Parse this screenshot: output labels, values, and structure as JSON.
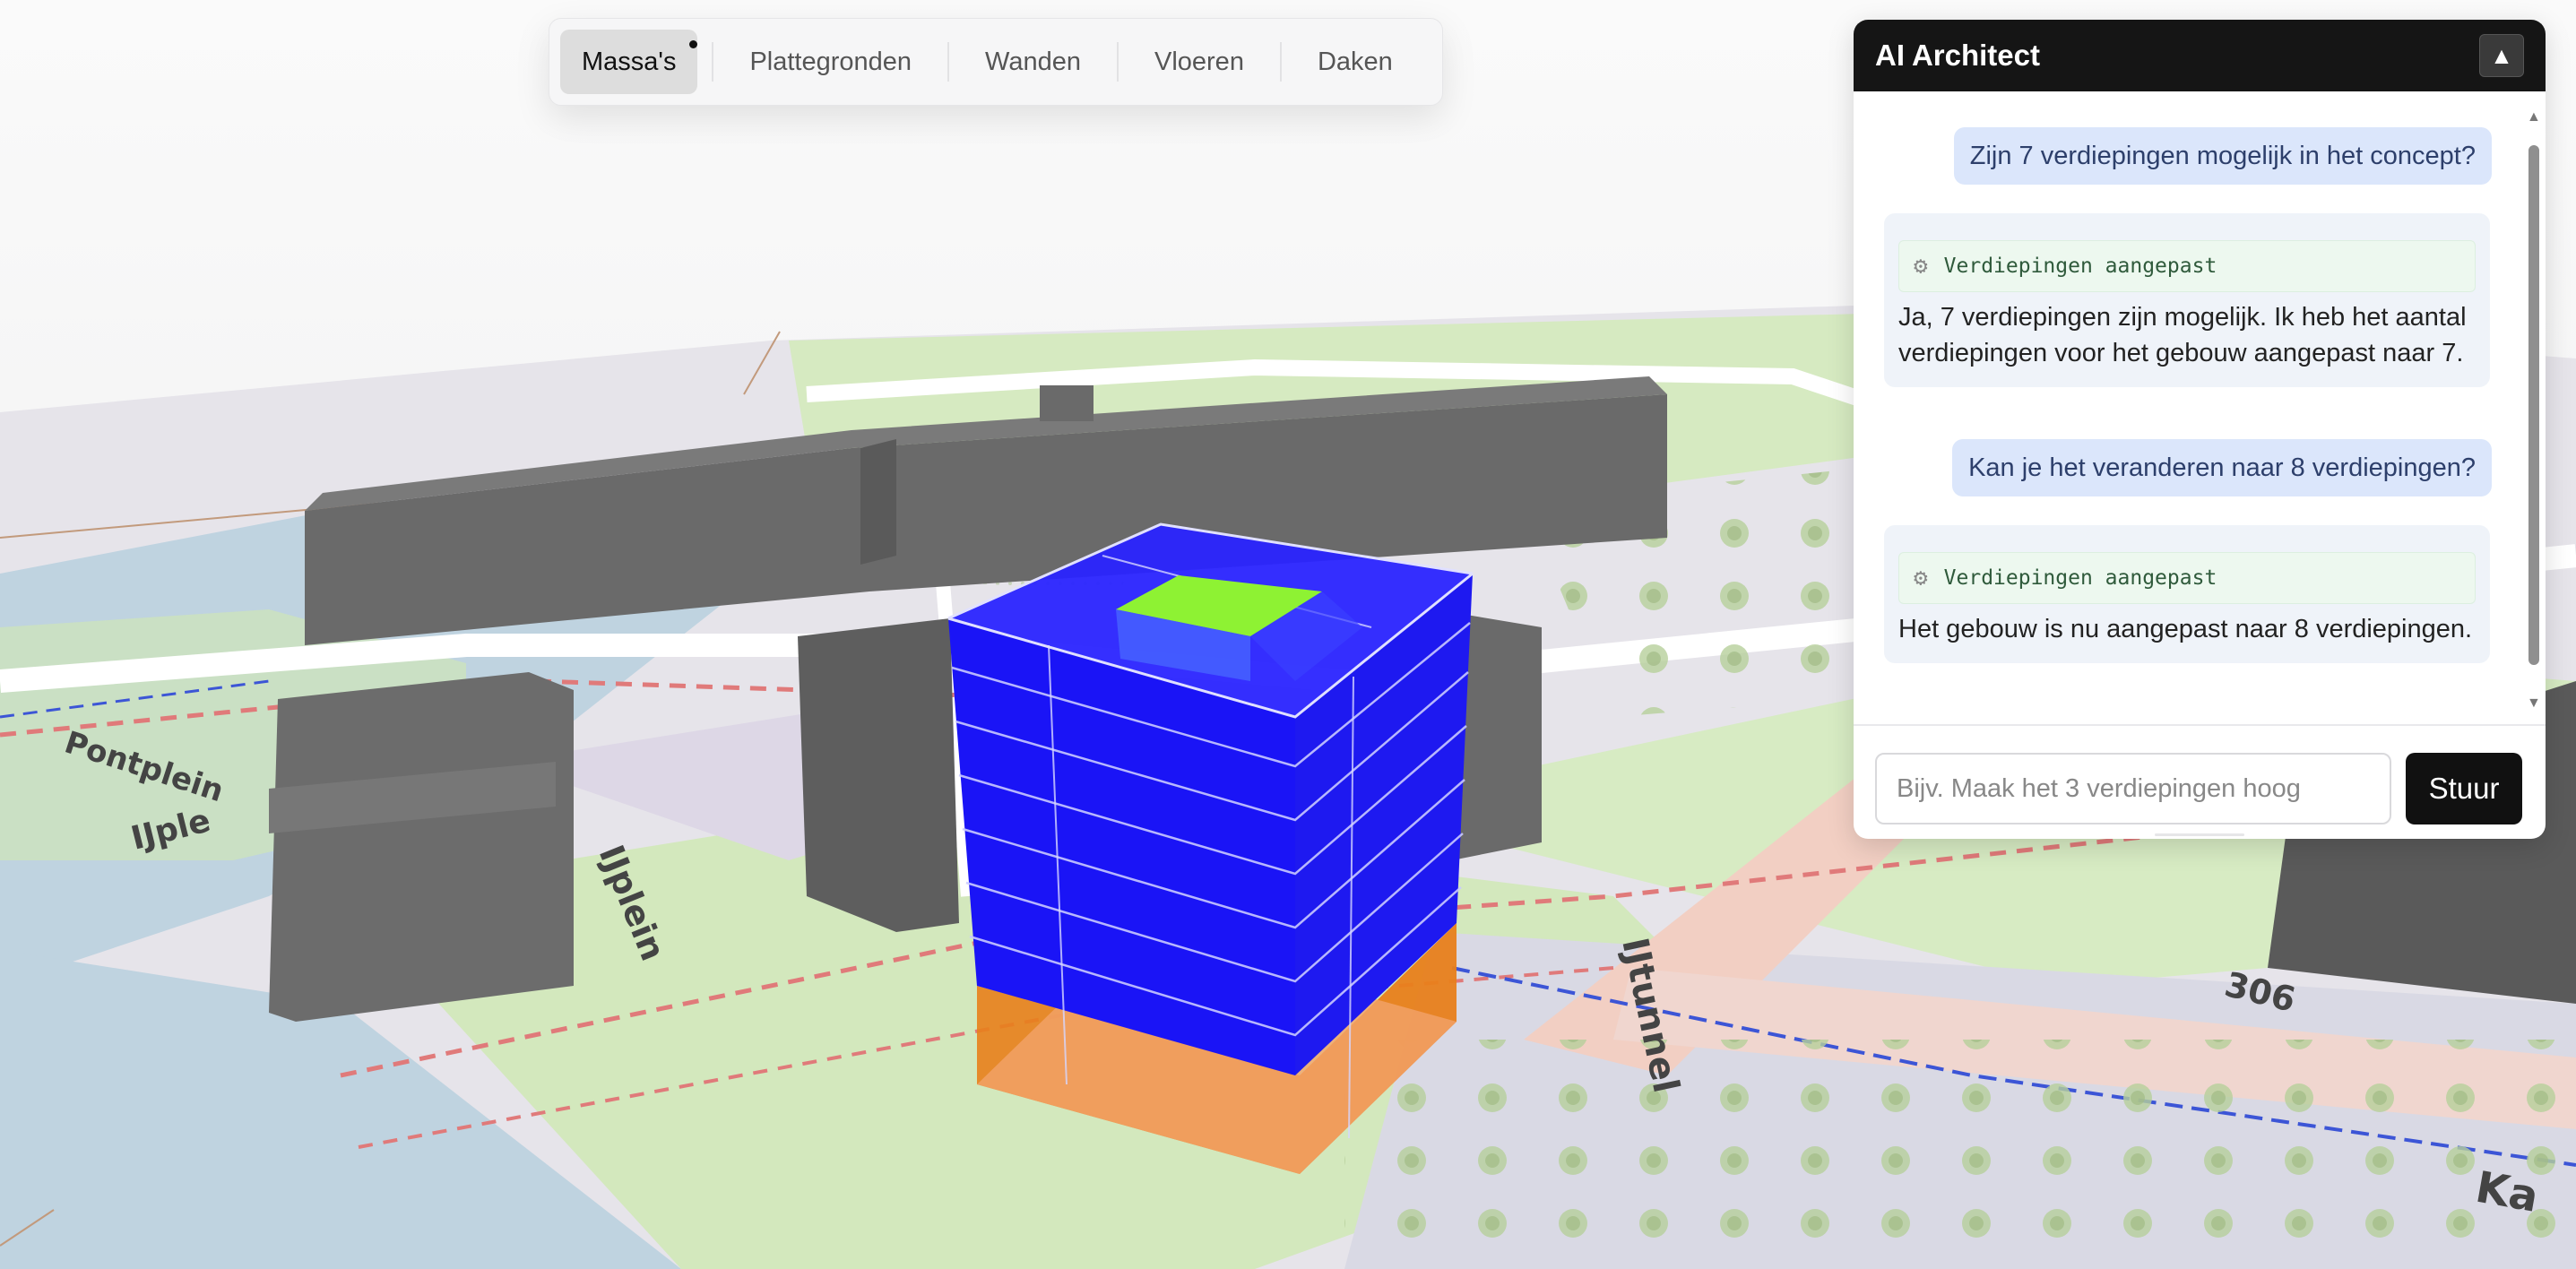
{
  "app": {
    "title": "AI Architect"
  },
  "toolbar": {
    "tabs": [
      {
        "label": "Massa's",
        "active": true
      },
      {
        "label": "Plattegronden",
        "active": false
      },
      {
        "label": "Wanden",
        "active": false
      },
      {
        "label": "Vloeren",
        "active": false
      },
      {
        "label": "Daken",
        "active": false
      }
    ]
  },
  "panel": {
    "title": "AI Architect",
    "collapse_icon": "triangle-up-icon",
    "messages": [
      {
        "role": "user",
        "text": "Zijn 7 verdiepingen mogelijk in het concept?"
      },
      {
        "role": "assistant",
        "tool": "Verdiepingen aangepast",
        "text": "Ja, 7 verdiepingen zijn mogelijk. Ik heb het aantal verdiepingen voor het gebouw aangepast naar 7."
      },
      {
        "role": "user",
        "text": "Kan je het veranderen naar 8 verdiepingen?"
      },
      {
        "role": "assistant",
        "tool": "Verdiepingen aangepast",
        "text": "Het gebouw is nu aangepast naar 8 verdiepingen."
      }
    ],
    "input": {
      "value": "",
      "placeholder": "Bijv. Maak het 3 verdiepingen hoog"
    },
    "send_label": "Stuur"
  },
  "map": {
    "labels": [
      "Pontplein",
      "IJple",
      "IJplein",
      "IJtunnel",
      "306",
      "Ka"
    ]
  },
  "colors": {
    "building_floor": "#1a14f6",
    "building_roof": "#8ef233",
    "building_base": "#e8801b",
    "neighbour_building": "#6e6e6e",
    "water": "#bfd3e0",
    "park": "#d6eac1"
  }
}
